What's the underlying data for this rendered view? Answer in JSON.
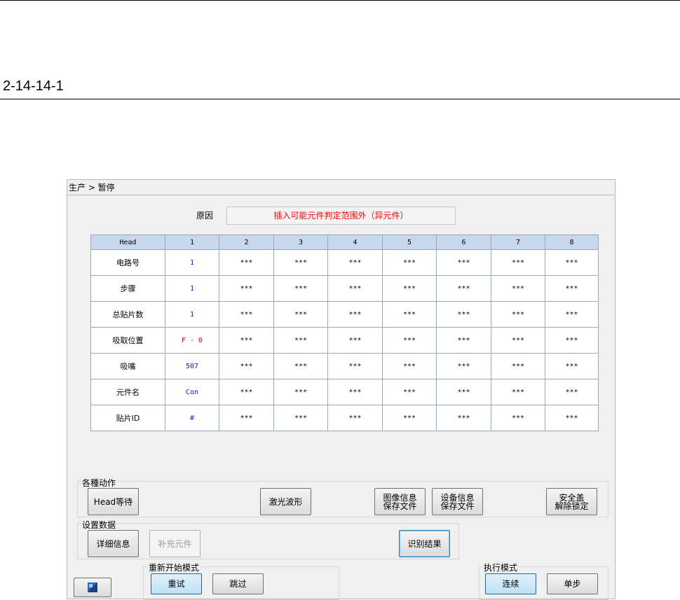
{
  "document": {
    "heading": "2-14-14-1"
  },
  "window": {
    "title": "生产 > 暂停",
    "reason_label": "原因",
    "reason_text": "插入可能元件判定范围外（异元件）"
  },
  "table": {
    "headers": [
      "Head",
      "1",
      "2",
      "3",
      "4",
      "5",
      "6",
      "7",
      "8"
    ],
    "rows": [
      {
        "label": "电路号",
        "head1": "1",
        "rest": [
          "***",
          "***",
          "***",
          "***",
          "***",
          "***",
          "***"
        ]
      },
      {
        "label": "步骤",
        "head1": "1",
        "rest": [
          "***",
          "***",
          "***",
          "***",
          "***",
          "***",
          "***"
        ]
      },
      {
        "label": "总贴片数",
        "head1": "1",
        "rest": [
          "***",
          "***",
          "***",
          "***",
          "***",
          "***",
          "***"
        ]
      },
      {
        "label": "吸取位置",
        "head1": "F - 0",
        "rest": [
          "***",
          "***",
          "***",
          "***",
          "***",
          "***",
          "***"
        ]
      },
      {
        "label": "吸嘴",
        "head1": "507",
        "rest": [
          "***",
          "***",
          "***",
          "***",
          "***",
          "***",
          "***"
        ]
      },
      {
        "label": "元件名",
        "head1": "Con",
        "rest": [
          "***",
          "***",
          "***",
          "***",
          "***",
          "***",
          "***"
        ]
      },
      {
        "label": "贴片ID",
        "head1": "#",
        "rest": [
          "***",
          "***",
          "***",
          "***",
          "***",
          "***",
          "***"
        ]
      }
    ]
  },
  "actions": {
    "label": "各種动作",
    "head_wait": "Head等待",
    "laser_waveform": "激光波形",
    "image_save_1": "图像信息",
    "image_save_2": "保存文件",
    "device_save_1": "设备信息",
    "device_save_2": "保存文件",
    "safety_1": "安全盖",
    "safety_2": "解除锁定"
  },
  "settings": {
    "label": "设置数据",
    "details": "详细信息",
    "supplement": "补充元件",
    "recognition": "识别结果"
  },
  "restart": {
    "label": "重新开始模式",
    "retry": "重试",
    "skip": "跳过"
  },
  "exec": {
    "label": "执行模式",
    "continuous": "连续",
    "step": "单步"
  },
  "icons": {
    "corner": "grid-icon"
  }
}
